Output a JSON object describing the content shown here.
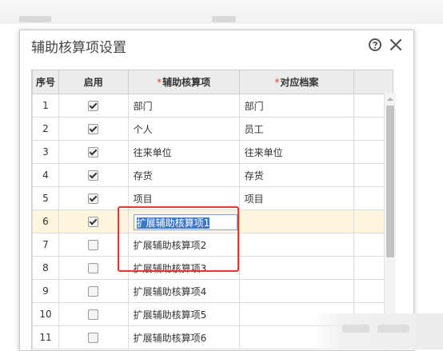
{
  "dialog": {
    "title": "辅助核算项设置",
    "help_icon": "help-circle-icon",
    "close_icon": "close-icon"
  },
  "table": {
    "headers": {
      "index": "序号",
      "enabled": "启用",
      "item": "辅助核算项",
      "archive": "对应档案"
    },
    "required_mark": "*",
    "rows": [
      {
        "index": "1",
        "enabled": true,
        "item": "部门",
        "archive": "部门"
      },
      {
        "index": "2",
        "enabled": true,
        "item": "个人",
        "archive": "员工"
      },
      {
        "index": "3",
        "enabled": true,
        "item": "往来单位",
        "archive": "往来单位"
      },
      {
        "index": "4",
        "enabled": true,
        "item": "存货",
        "archive": "存货"
      },
      {
        "index": "5",
        "enabled": true,
        "item": "项目",
        "archive": "项目"
      },
      {
        "index": "6",
        "enabled": true,
        "item": "扩展辅助核算项1",
        "archive": ""
      },
      {
        "index": "7",
        "enabled": false,
        "item": "扩展辅助核算项2",
        "archive": ""
      },
      {
        "index": "8",
        "enabled": false,
        "item": "扩展辅助核算项3",
        "archive": ""
      },
      {
        "index": "9",
        "enabled": false,
        "item": "扩展辅助核算项4",
        "archive": ""
      },
      {
        "index": "10",
        "enabled": false,
        "item": "扩展辅助核算项5",
        "archive": ""
      },
      {
        "index": "11",
        "enabled": false,
        "item": "扩展辅助核算项6",
        "archive": ""
      }
    ],
    "selected_row": "6"
  },
  "colors": {
    "accent_highlight": "#e8352f",
    "selected_row_bg": "#fdf6dd",
    "required_mark": "#e0402f",
    "text_selection": "#3b78c9"
  }
}
